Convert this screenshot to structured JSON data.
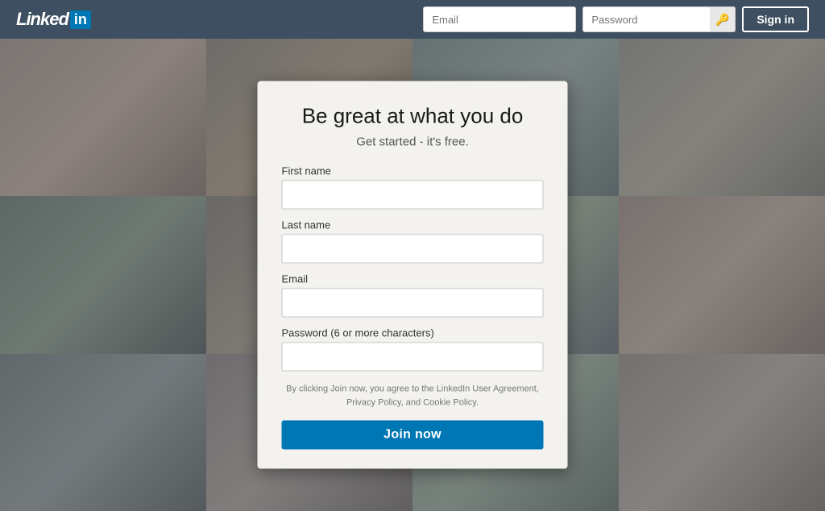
{
  "header": {
    "logo_text": "Linked",
    "logo_in": "in",
    "email_placeholder": "Email",
    "password_placeholder": "Password",
    "sign_in_label": "Sign in",
    "password_icon": "🔑"
  },
  "modal": {
    "title": "Be great at what you do",
    "subtitle": "Get started - it's free.",
    "first_name_label": "First name",
    "last_name_label": "Last name",
    "email_label": "Email",
    "password_label": "Password (6 or more characters)",
    "terms_text": "By clicking Join now, you agree to the LinkedIn User Agreement, Privacy Policy, and Cookie Policy.",
    "join_label": "Join now"
  },
  "colors": {
    "brand_blue": "#0077b5",
    "header_bg": "#3d4f60"
  }
}
